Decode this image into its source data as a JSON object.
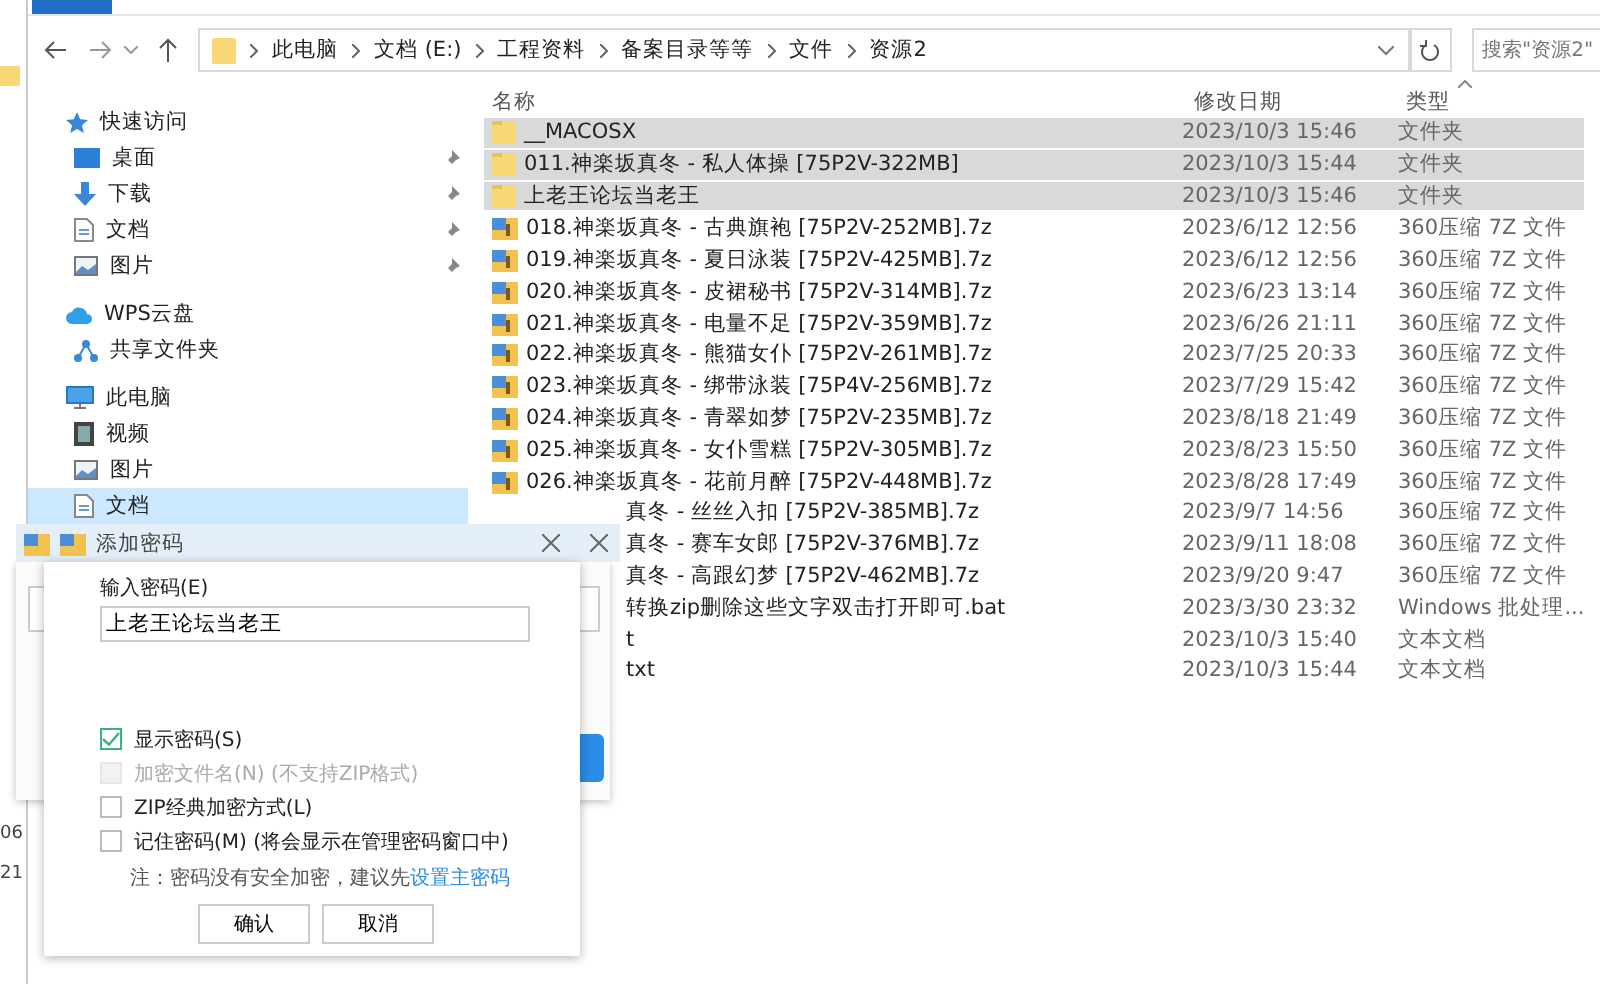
{
  "address": {
    "crumbs": [
      "此电脑",
      "文档 (E:)",
      "工程资料",
      "备案目录等等",
      "文件",
      "资源2"
    ]
  },
  "search": {
    "placeholder": "搜索\"资源2\""
  },
  "side_window": {
    "texts": [
      "06",
      "21"
    ]
  },
  "sidebar": {
    "groups": [
      {
        "label": "快速访问",
        "children": [
          {
            "label": "桌面",
            "pinned": true,
            "selected": false
          },
          {
            "label": "下载",
            "pinned": true,
            "selected": false
          },
          {
            "label": "文档",
            "pinned": true,
            "selected": false
          },
          {
            "label": "图片",
            "pinned": true,
            "selected": false
          }
        ]
      },
      {
        "label": "WPS云盘",
        "children": [
          {
            "label": "共享文件夹",
            "pinned": false,
            "selected": false
          }
        ]
      },
      {
        "label": "此电脑",
        "children": [
          {
            "label": "视频",
            "pinned": false,
            "selected": false
          },
          {
            "label": "图片",
            "pinned": false,
            "selected": false
          },
          {
            "label": "文档",
            "pinned": false,
            "selected": true
          }
        ]
      }
    ]
  },
  "table": {
    "columns": [
      "名称",
      "修改日期",
      "类型"
    ],
    "rows": [
      {
        "kind": "folder",
        "name": "__MACOSX",
        "date": "2023/10/3 15:46",
        "type": "文件夹",
        "selected": true
      },
      {
        "kind": "folder",
        "name": "011.神楽坂真冬 - 私人体操 [75P2V-322MB]",
        "date": "2023/10/3 15:44",
        "type": "文件夹",
        "selected": true
      },
      {
        "kind": "folder",
        "name": "上老王论坛当老王",
        "date": "2023/10/3 15:46",
        "type": "文件夹",
        "selected": true
      },
      {
        "kind": "archive",
        "name": "018.神楽坂真冬 - 古典旗袍 [75P2V-252MB].7z",
        "date": "2023/6/12 12:56",
        "type": "360压缩 7Z 文件",
        "selected": false
      },
      {
        "kind": "archive",
        "name": "019.神楽坂真冬 - 夏日泳装 [75P2V-425MB].7z",
        "date": "2023/6/12 12:56",
        "type": "360压缩 7Z 文件",
        "selected": false
      },
      {
        "kind": "archive",
        "name": "020.神楽坂真冬 - 皮裙秘书 [75P2V-314MB].7z",
        "date": "2023/6/23 13:14",
        "type": "360压缩 7Z 文件",
        "selected": false
      },
      {
        "kind": "archive",
        "name": "021.神楽坂真冬 - 电量不足 [75P2V-359MB].7z",
        "date": "2023/6/26 21:11",
        "type": "360压缩 7Z 文件",
        "selected": false
      },
      {
        "kind": "archive",
        "name": "022.神楽坂真冬 - 熊猫女仆 [75P2V-261MB].7z",
        "date": "2023/7/25 20:33",
        "type": "360压缩 7Z 文件",
        "selected": false
      },
      {
        "kind": "archive",
        "name": "023.神楽坂真冬 - 绑带泳装 [75P4V-256MB].7z",
        "date": "2023/7/29 15:42",
        "type": "360压缩 7Z 文件",
        "selected": false
      },
      {
        "kind": "archive",
        "name": "024.神楽坂真冬 - 青翠如梦 [75P2V-235MB].7z",
        "date": "2023/8/18 21:49",
        "type": "360压缩 7Z 文件",
        "selected": false
      },
      {
        "kind": "archive",
        "name": "025.神楽坂真冬 - 女仆雪糕 [75P2V-305MB].7z",
        "date": "2023/8/23 15:50",
        "type": "360压缩 7Z 文件",
        "selected": false
      },
      {
        "kind": "archive",
        "name": "026.神楽坂真冬 - 花前月醉 [75P2V-448MB].7z",
        "date": "2023/8/28 17:49",
        "type": "360压缩 7Z 文件",
        "selected": false
      },
      {
        "kind": "partial",
        "name": "真冬 - 丝丝入扣 [75P2V-385MB].7z",
        "date": "2023/9/7 14:56",
        "type": "360压缩 7Z 文件",
        "selected": false
      },
      {
        "kind": "partial",
        "name": "真冬 - 赛车女郎 [75P2V-376MB].7z",
        "date": "2023/9/11 18:08",
        "type": "360压缩 7Z 文件",
        "selected": false
      },
      {
        "kind": "partial",
        "name": "真冬 - 高跟幻梦 [75P2V-462MB].7z",
        "date": "2023/9/20 9:47",
        "type": "360压缩 7Z 文件",
        "selected": false
      },
      {
        "kind": "partial",
        "name": "转换zip删除这些文字双击打开即可.bat",
        "date": "2023/3/30 23:32",
        "type": "Windows 批处理...",
        "selected": false
      },
      {
        "kind": "partial",
        "name": "t",
        "date": "2023/10/3 15:40",
        "type": "文本文档",
        "selected": false
      },
      {
        "kind": "partial",
        "name": "txt",
        "date": "2023/10/3 15:44",
        "type": "文本文档",
        "selected": false
      }
    ]
  },
  "dialog": {
    "title": "添加密码",
    "password_label": "输入密码(E)",
    "password_value": "上老王论坛当老王",
    "options": [
      {
        "label": "显示密码(S)",
        "checked": true,
        "disabled": false
      },
      {
        "label": "加密文件名(N) (不支持ZIP格式)",
        "checked": false,
        "disabled": true
      },
      {
        "label": "ZIP经典加密方式(L)",
        "checked": false,
        "disabled": false
      },
      {
        "label": "记住密码(M) (将会显示在管理密码窗口中)",
        "checked": false,
        "disabled": false
      }
    ],
    "note": "注：密码没有安全加密，建议先",
    "note_link": "设置主密码",
    "buttons": [
      "确认",
      "取消"
    ]
  }
}
